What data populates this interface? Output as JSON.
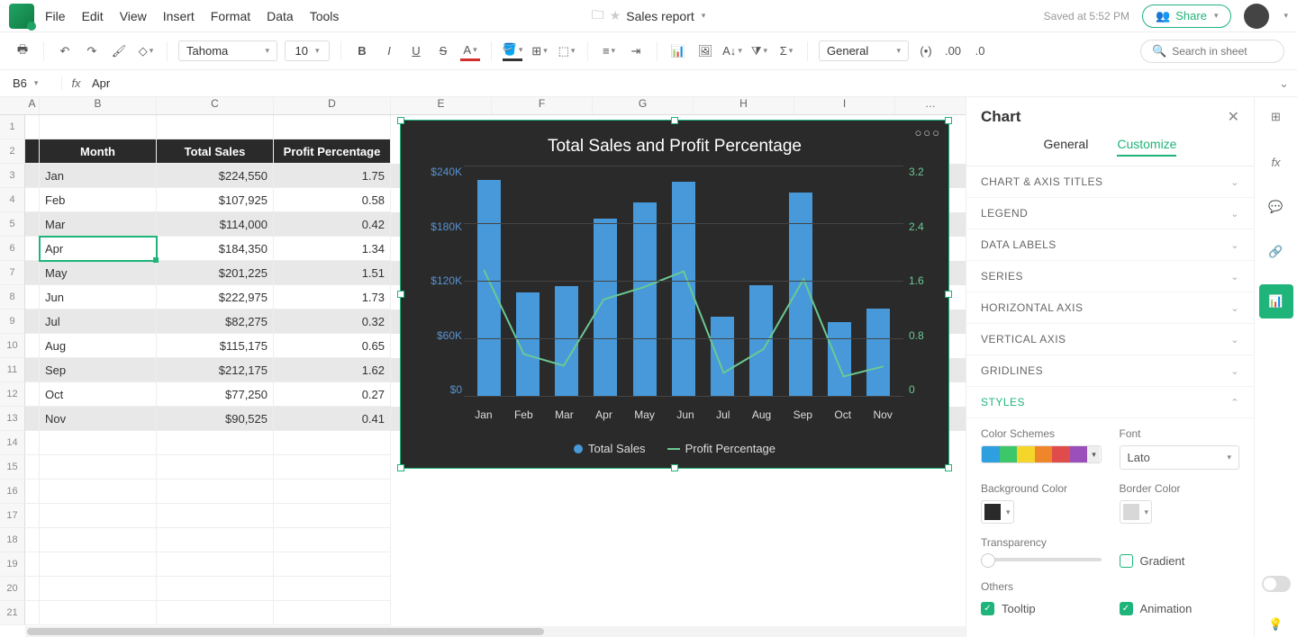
{
  "menus": [
    "File",
    "Edit",
    "View",
    "Insert",
    "Format",
    "Data",
    "Tools"
  ],
  "doc": {
    "name": "Sales report"
  },
  "saved": "Saved at 5:52 PM",
  "share": "Share",
  "toolbar": {
    "font": "Tahoma",
    "size": "10",
    "number_format": "General",
    "search_placeholder": "Search in sheet"
  },
  "formula": {
    "cell": "B6",
    "value": "Apr"
  },
  "columns": [
    "A",
    "B",
    "C",
    "D",
    "E",
    "F",
    "G",
    "H",
    "I"
  ],
  "table": {
    "headers": [
      "Month",
      "Total Sales",
      "Profit Percentage"
    ],
    "rows": [
      {
        "m": "Jan",
        "s": "$224,550",
        "p": "1.75"
      },
      {
        "m": "Feb",
        "s": "$107,925",
        "p": "0.58"
      },
      {
        "m": "Mar",
        "s": "$114,000",
        "p": "0.42"
      },
      {
        "m": "Apr",
        "s": "$184,350",
        "p": "1.34"
      },
      {
        "m": "May",
        "s": "$201,225",
        "p": "1.51"
      },
      {
        "m": "Jun",
        "s": "$222,975",
        "p": "1.73"
      },
      {
        "m": "Jul",
        "s": "$82,275",
        "p": "0.32"
      },
      {
        "m": "Aug",
        "s": "$115,175",
        "p": "0.65"
      },
      {
        "m": "Sep",
        "s": "$212,175",
        "p": "1.62"
      },
      {
        "m": "Oct",
        "s": "$77,250",
        "p": "0.27"
      },
      {
        "m": "Nov",
        "s": "$90,525",
        "p": "0.41"
      }
    ]
  },
  "chart_data": {
    "type": "bar+line",
    "title": "Total Sales and Profit Percentage",
    "categories": [
      "Jan",
      "Feb",
      "Mar",
      "Apr",
      "May",
      "Jun",
      "Jul",
      "Aug",
      "Sep",
      "Oct",
      "Nov"
    ],
    "series": [
      {
        "name": "Total Sales",
        "axis": "left",
        "type": "bar",
        "values": [
          224550,
          107925,
          114000,
          184350,
          201225,
          222975,
          82275,
          115175,
          212175,
          77250,
          90525
        ]
      },
      {
        "name": "Profit Percentage",
        "axis": "right",
        "type": "line",
        "values": [
          1.75,
          0.58,
          0.42,
          1.34,
          1.51,
          1.73,
          0.32,
          0.65,
          1.62,
          0.27,
          0.41
        ]
      }
    ],
    "y_left": {
      "ticks": [
        "$240K",
        "$180K",
        "$120K",
        "$60K",
        "$0"
      ],
      "max": 240000
    },
    "y_right": {
      "ticks": [
        "3.2",
        "2.4",
        "1.6",
        "0.8",
        "0"
      ],
      "max": 3.2
    },
    "legend": [
      "Total Sales",
      "Profit Percentage"
    ]
  },
  "panel": {
    "title": "Chart",
    "tabs": [
      "General",
      "Customize"
    ],
    "sections": [
      "CHART & AXIS TITLES",
      "LEGEND",
      "DATA LABELS",
      "SERIES",
      "HORIZONTAL AXIS",
      "VERTICAL AXIS",
      "GRIDLINES",
      "STYLES"
    ],
    "styles": {
      "color_schemes": "Color Schemes",
      "scheme_colors": [
        "#2f9fe0",
        "#3cc76a",
        "#f4d52a",
        "#f0862a",
        "#e04c4c",
        "#9b4fbb"
      ],
      "font": "Font",
      "font_value": "Lato",
      "bg_color": "Background Color",
      "bg_value": "#2a2a2a",
      "border_color": "Border Color",
      "border_value": "#d8d8d8",
      "transparency": "Transparency",
      "gradient": "Gradient",
      "others": "Others",
      "tooltip": "Tooltip",
      "animation": "Animation"
    }
  }
}
